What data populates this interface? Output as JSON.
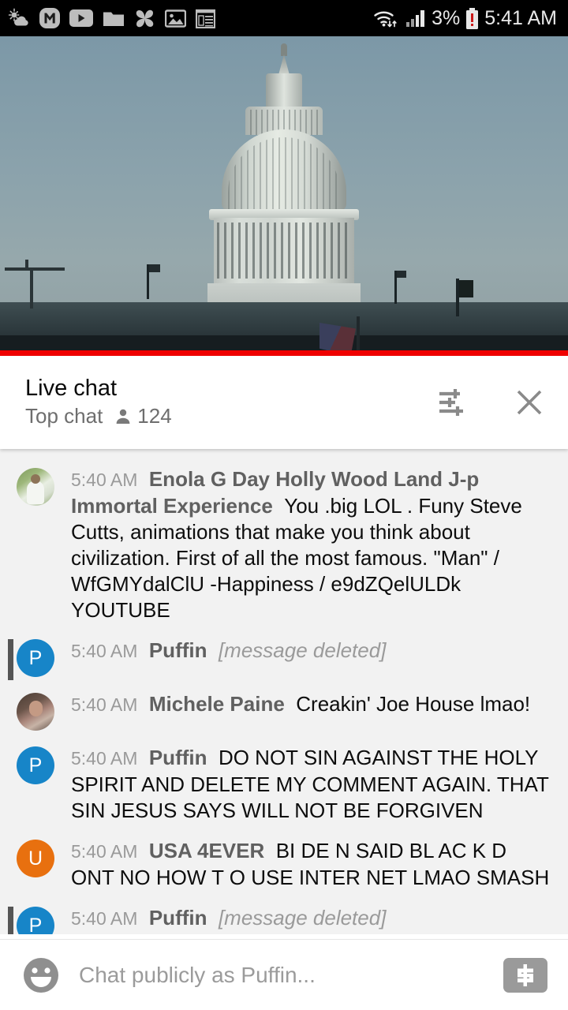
{
  "status_bar": {
    "time": "5:41 AM",
    "battery_percent": "3%",
    "left_icons": [
      "weather-partly-cloudy-icon",
      "messaging-m-icon",
      "youtube-icon",
      "folder-icon",
      "pinwheel-icon",
      "photos-icon",
      "notepad-icon"
    ],
    "right_icons": [
      "wifi-icon",
      "cellular-signal-icon",
      "battery-low-icon"
    ],
    "colors": {
      "background": "#000000",
      "text": "#e8e8e8",
      "battery_low": "#d31f1f"
    }
  },
  "video": {
    "label": "us-capitol-live-stream",
    "progress_bar_color": "#f00000"
  },
  "chat_header": {
    "title": "Live chat",
    "mode": "Top chat",
    "viewer_count": "124",
    "viewer_icon": "person-icon",
    "filter_icon": "tune-icon",
    "close_icon": "close-icon"
  },
  "messages": [
    {
      "timestamp": "5:40 AM",
      "author": "Enola G Day Holly Wood Land J-p Immortal Experience",
      "text": "You .big LOL . Funy Steve Cutts, animations that make you think about civilization. First of all the most famous. \"Man\" / WfGMYdalClU -Happiness / e9dZQelULDk YOUTUBE",
      "avatar_type": "photo",
      "avatar_letter": "",
      "avatar_color": "",
      "deleted": false,
      "own": false
    },
    {
      "timestamp": "5:40 AM",
      "author": "Puffin",
      "text": "[message deleted]",
      "avatar_type": "letter",
      "avatar_letter": "P",
      "avatar_color": "#1785c8",
      "deleted": true,
      "own": true
    },
    {
      "timestamp": "5:40 AM",
      "author": "Michele Paine",
      "text": "Creakin' Joe House lmao!",
      "avatar_type": "photo",
      "avatar_letter": "",
      "avatar_color": "",
      "deleted": false,
      "own": false
    },
    {
      "timestamp": "5:40 AM",
      "author": "Puffin",
      "text": "DO NOT SIN AGAINST THE HOLY SPIRIT AND DELETE MY COMMENT AGAIN. THAT SIN JESUS SAYS WILL NOT BE FORGIVEN",
      "avatar_type": "letter",
      "avatar_letter": "P",
      "avatar_color": "#1785c8",
      "deleted": false,
      "own": false
    },
    {
      "timestamp": "5:40 AM",
      "author": "USA 4EVER",
      "text": "BI DE N SAID BL AC K D ONT NO HOW T O USE INTER NET LMAO SMASH",
      "avatar_type": "letter",
      "avatar_letter": "U",
      "avatar_color": "#e8700f",
      "deleted": false,
      "own": false
    },
    {
      "timestamp": "5:40 AM",
      "author": "Puffin",
      "text": "[message deleted]",
      "avatar_type": "letter",
      "avatar_letter": "P",
      "avatar_color": "#1785c8",
      "deleted": true,
      "own": true
    }
  ],
  "input_bar": {
    "emoji_icon": "emoji-smiley-icon",
    "placeholder": "Chat publicly as Puffin...",
    "superchat_icon": "dollar-sign-icon"
  }
}
